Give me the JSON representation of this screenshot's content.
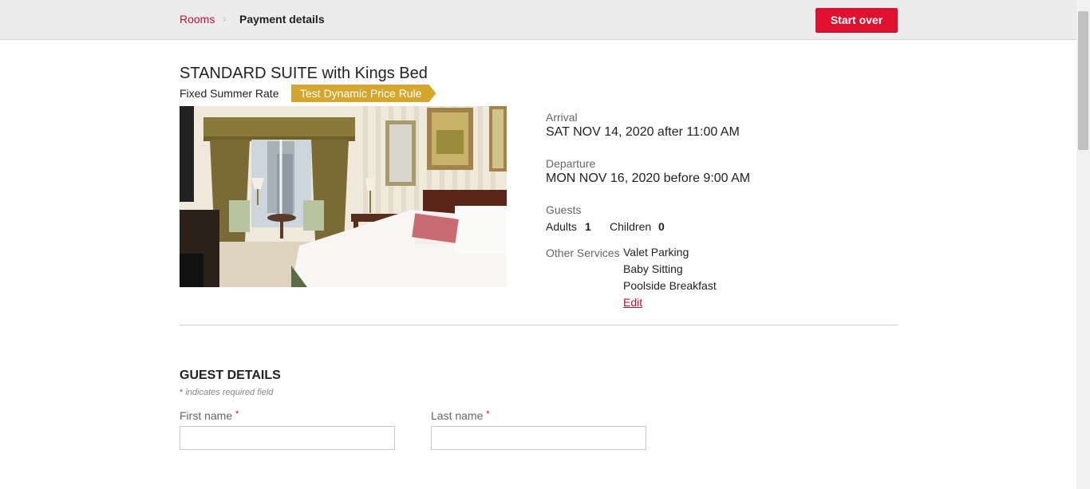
{
  "breadcrumb": {
    "rooms": "Rooms",
    "separator": "›",
    "current": "Payment details"
  },
  "header": {
    "start_over": "Start over"
  },
  "room": {
    "title": "STANDARD SUITE with Kings Bed",
    "rate": "Fixed Summer Rate",
    "price_rule_tag": "Test Dynamic Price Rule"
  },
  "stay": {
    "arrival_label": "Arrival",
    "arrival_value": "SAT NOV 14, 2020 after 11:00 AM",
    "departure_label": "Departure",
    "departure_value": "MON NOV 16, 2020 before 9:00 AM",
    "guests_label": "Guests",
    "adults_label": "Adults",
    "adults_value": "1",
    "children_label": "Children",
    "children_value": "0",
    "services_label": "Other Services",
    "services": [
      "Valet Parking",
      "Baby Sitting",
      "Poolside Breakfast"
    ],
    "edit": "Edit"
  },
  "guest_details": {
    "title": "GUEST DETAILS",
    "required_star": "*",
    "required_note": "indicates required field",
    "first_name_label": "First name",
    "last_name_label": "Last name",
    "first_name_value": "",
    "last_name_value": ""
  },
  "colors": {
    "accent": "#e0102f",
    "tag": "#d4a72c",
    "link": "#c8102e"
  }
}
